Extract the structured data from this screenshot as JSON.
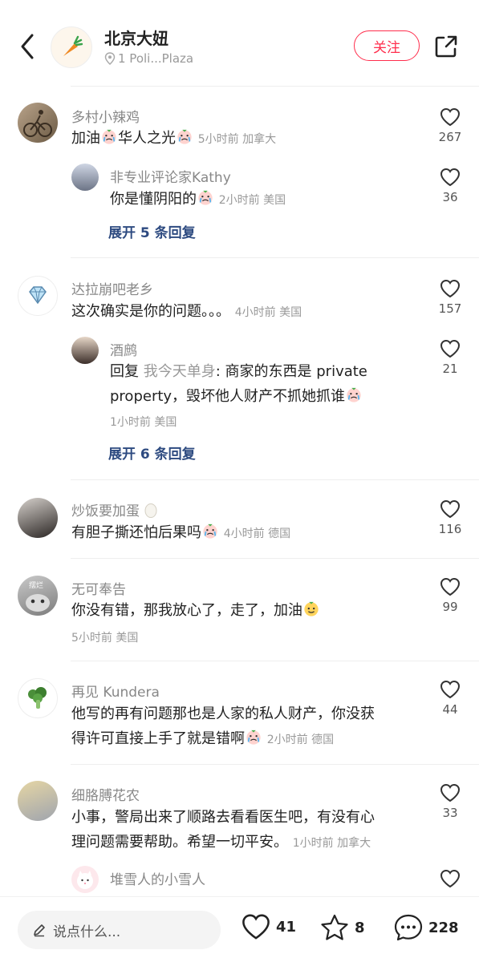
{
  "header": {
    "title": "北京大妞",
    "location": "1 Poli...Plaza",
    "follow_label": "关注"
  },
  "comments": [
    {
      "user": "多村小辣鸡",
      "text_a": "加油",
      "text_b": "华人之光",
      "meta": "5小时前 加拿大",
      "likes": "267",
      "reply": {
        "user": "非专业评论家Kathy",
        "text": "你是懂阴阳的",
        "meta": "2小时前 美国",
        "likes": "36"
      },
      "expand": "展开 5 条回复"
    },
    {
      "user": "达拉崩吧老乡",
      "text": "这次确实是你的问题。。。",
      "meta": "4小时前 美国",
      "likes": "157",
      "reply": {
        "user": "酒鹧",
        "prefix": "回复",
        "quoted_user": "我今天单身",
        "text_line1": ": 商家的东西是 private",
        "text_line2": "property，毁坏他人财产不抓她抓谁",
        "meta": "1小时前 美国",
        "likes": "21"
      },
      "expand": "展开 6 条回复"
    },
    {
      "user": "炒饭要加蛋",
      "text": "有胆子撕还怕后果吗",
      "meta": "4小时前 德国",
      "likes": "116"
    },
    {
      "user": "无可奉告",
      "avatar_label": "摆烂",
      "text": "你没有错，那我放心了，走了，加油",
      "meta": "5小时前 美国",
      "likes": "99"
    },
    {
      "user": "再见 Kundera",
      "text_line1": "他写的再有问题那也是人家的私人财产，你没获",
      "text_line2": "得许可直接上手了就是错啊",
      "meta": "2小时前 德国",
      "likes": "44"
    },
    {
      "user": "细胳膊花农",
      "text_line1": "小事，警局出来了顺路去看看医生吧，有没有心",
      "text_line2": "理问题需要帮助。希望一切平安。",
      "meta": "1小时前 加拿大",
      "likes": "33",
      "reply": {
        "user": "堆雪人的小雪人"
      }
    }
  ],
  "bottom": {
    "input_placeholder": "说点什么...",
    "likes": "41",
    "stars": "8",
    "comments": "228"
  },
  "colors": {
    "accent": "#ff2e4d",
    "link": "#2d4a80",
    "muted": "#999999"
  }
}
